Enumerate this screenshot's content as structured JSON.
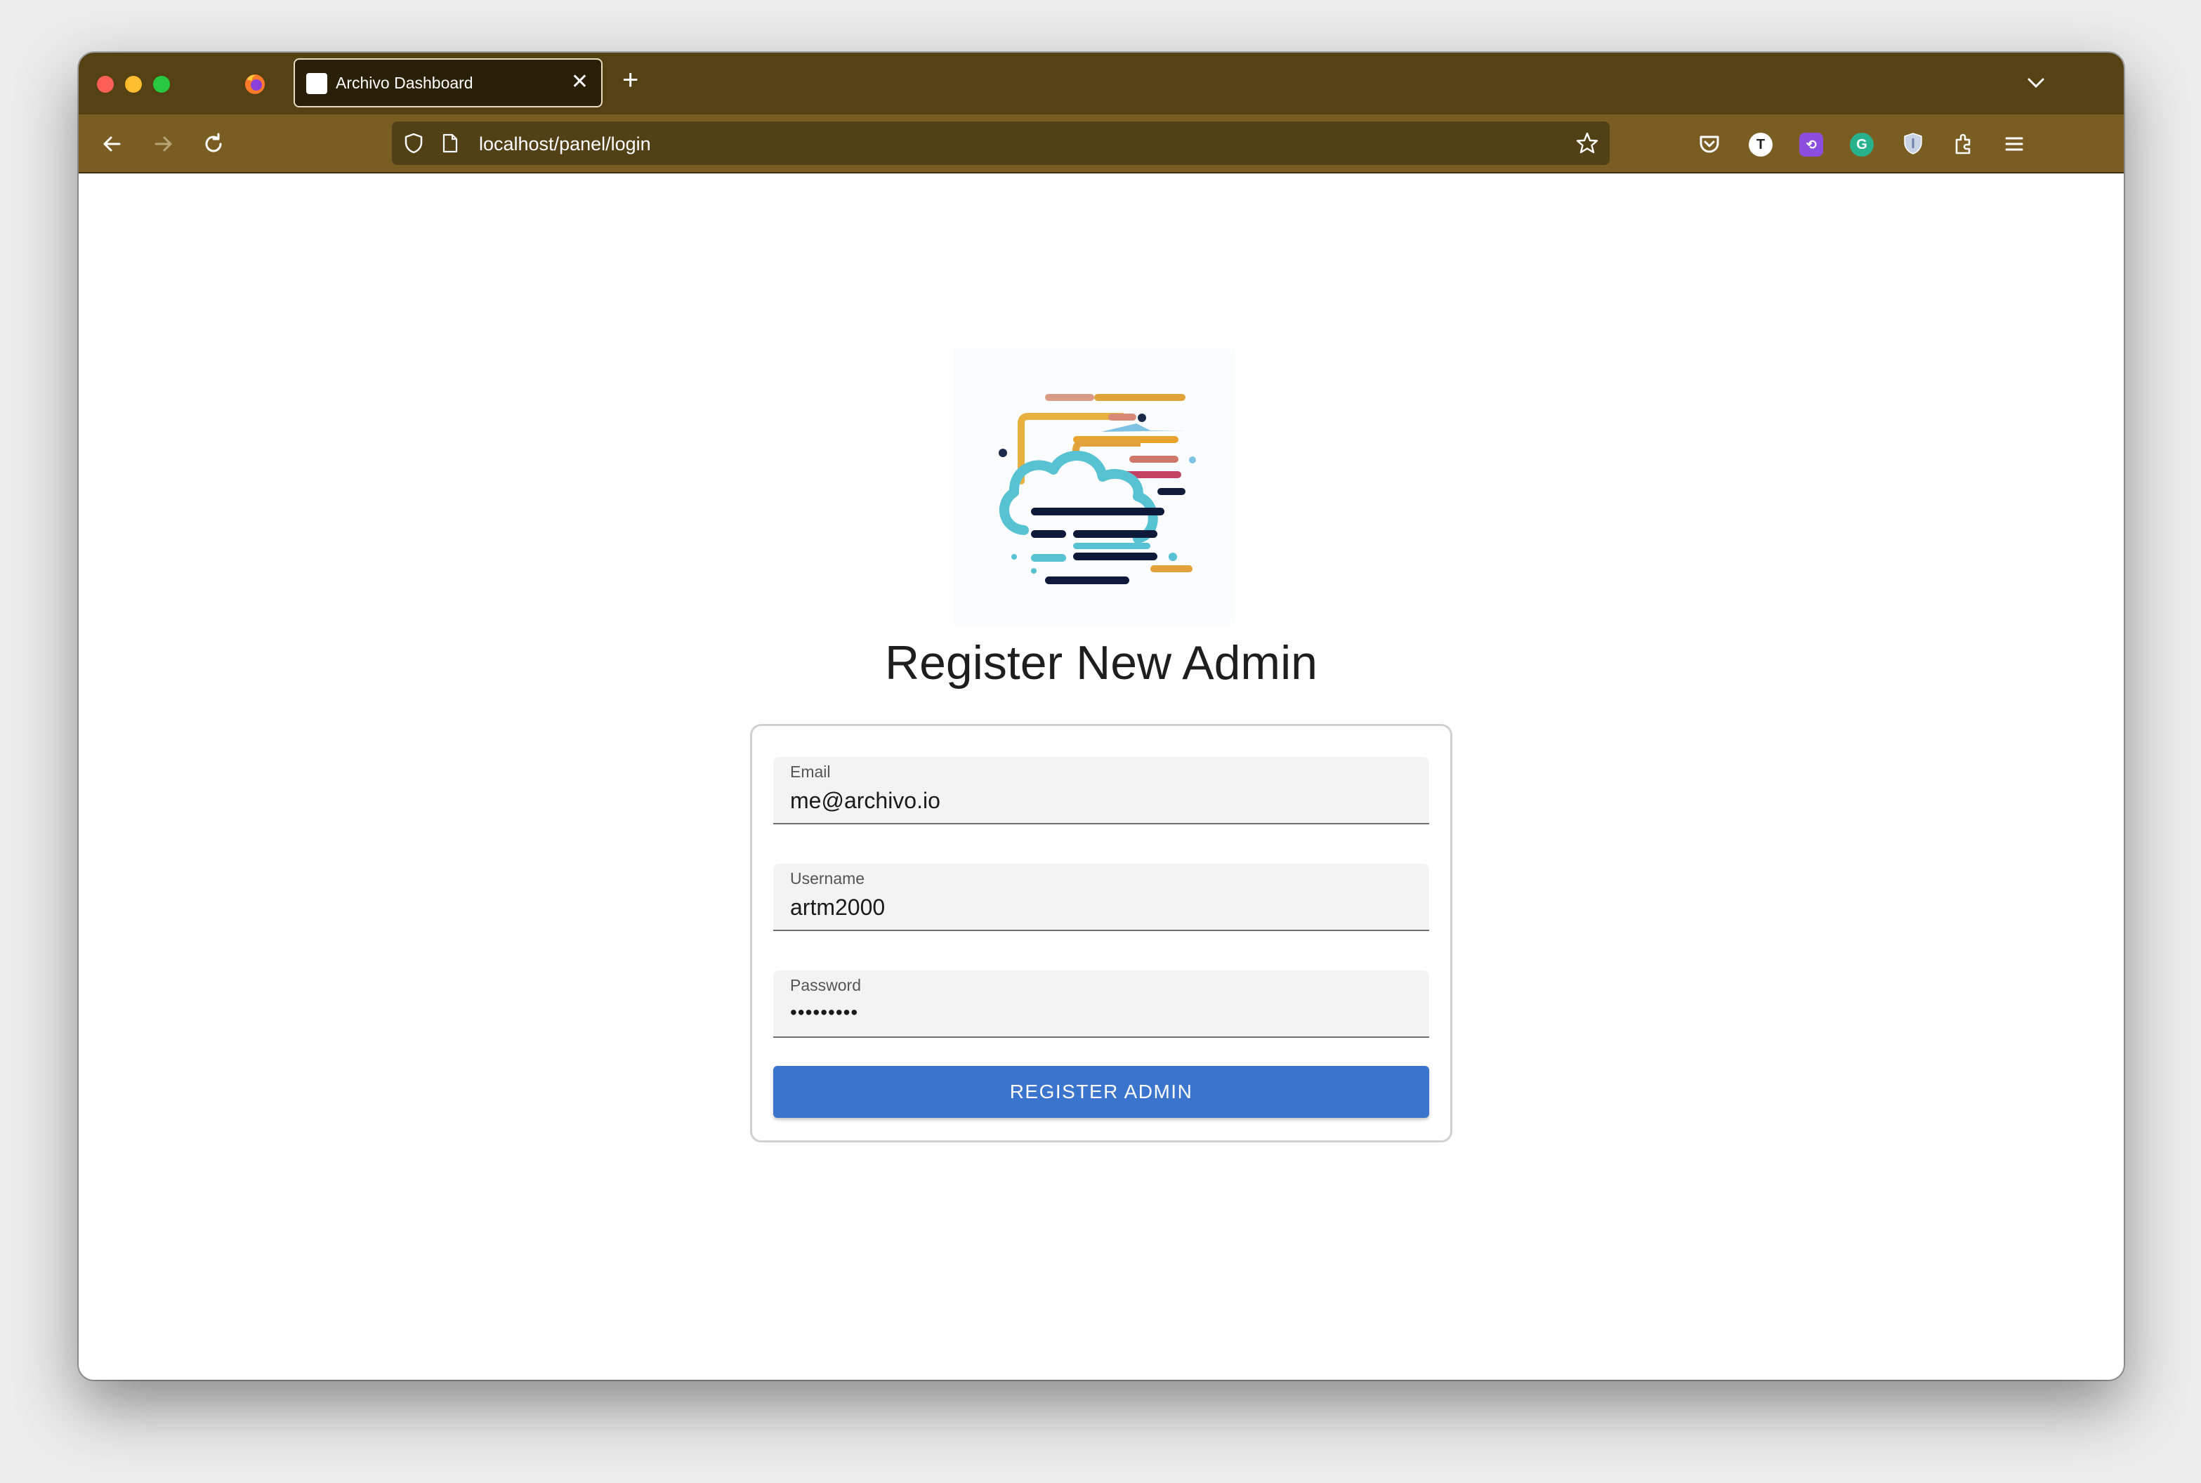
{
  "browser": {
    "tab": {
      "title": "Archivo Dashboard",
      "close_glyph": "✕"
    },
    "new_tab_glyph": "+",
    "url": "localhost/panel/login",
    "extensions": [
      {
        "name": "pocket-icon"
      },
      {
        "name": "extension-t-icon",
        "letter": "T",
        "color": "#ffffff"
      },
      {
        "name": "extension-purple-icon",
        "color": "#8b4fe0"
      },
      {
        "name": "grammarly-icon",
        "letter": "G",
        "color": "#27b28b"
      },
      {
        "name": "privacy-shield-icon"
      },
      {
        "name": "extensions-puzzle-icon"
      },
      {
        "name": "menu-icon"
      }
    ]
  },
  "page": {
    "title": "Register New Admin",
    "form": {
      "email": {
        "label": "Email",
        "value": "me@archivo.io"
      },
      "username": {
        "label": "Username",
        "value": "artm2000"
      },
      "password": {
        "label": "Password",
        "value": "•••••••••"
      },
      "submit_label": "REGISTER ADMIN"
    }
  },
  "colors": {
    "tabbar": "#544214",
    "navbar": "#7a5d22",
    "button": "#3a74cc"
  }
}
